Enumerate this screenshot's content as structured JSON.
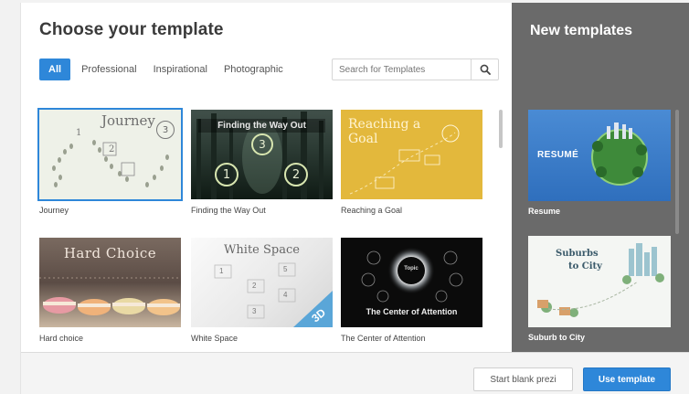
{
  "dialog": {
    "title": "Choose your template"
  },
  "filters": [
    {
      "label": "All",
      "active": true
    },
    {
      "label": "Professional",
      "active": false
    },
    {
      "label": "Inspirational",
      "active": false
    },
    {
      "label": "Photographic",
      "active": false
    }
  ],
  "search": {
    "placeholder": "Search for Templates",
    "icon": "magnifier-icon"
  },
  "templates": [
    {
      "caption": "Journey",
      "thumb_text": "Journey",
      "thumb_numbers": [
        "1",
        "2",
        "3"
      ],
      "selected": true
    },
    {
      "caption": "Finding the Way Out",
      "thumb_text": "Finding the Way Out",
      "thumb_numbers": [
        "1",
        "2",
        "3"
      ],
      "selected": false
    },
    {
      "caption": "Reaching a Goal",
      "thumb_text": "Reaching a Goal",
      "selected": false
    },
    {
      "caption": "Hard choice",
      "thumb_text": "Hard Choice",
      "selected": false
    },
    {
      "caption": "White Space",
      "thumb_text": "White Space",
      "thumb_numbers": [
        "1",
        "2",
        "3",
        "4",
        "5"
      ],
      "thumb_badge": "3D",
      "selected": false
    },
    {
      "caption": "The Center of Attention",
      "thumb_text": "The Center of Attention",
      "thumb_center": "Topic",
      "selected": false
    }
  ],
  "sidebar": {
    "title": "New templates",
    "items": [
      {
        "caption": "Resume",
        "thumb_text": "RESUMÉ"
      },
      {
        "caption": "Suburb to City",
        "thumb_text_1": "Suburbs",
        "thumb_text_2": "to City"
      }
    ]
  },
  "footer": {
    "start_blank": "Start blank prezi",
    "use_template": "Use template"
  },
  "colors": {
    "accent": "#2e87d9",
    "sidebar_bg": "#6a6a6a",
    "goal_yellow": "#e3b83c"
  }
}
